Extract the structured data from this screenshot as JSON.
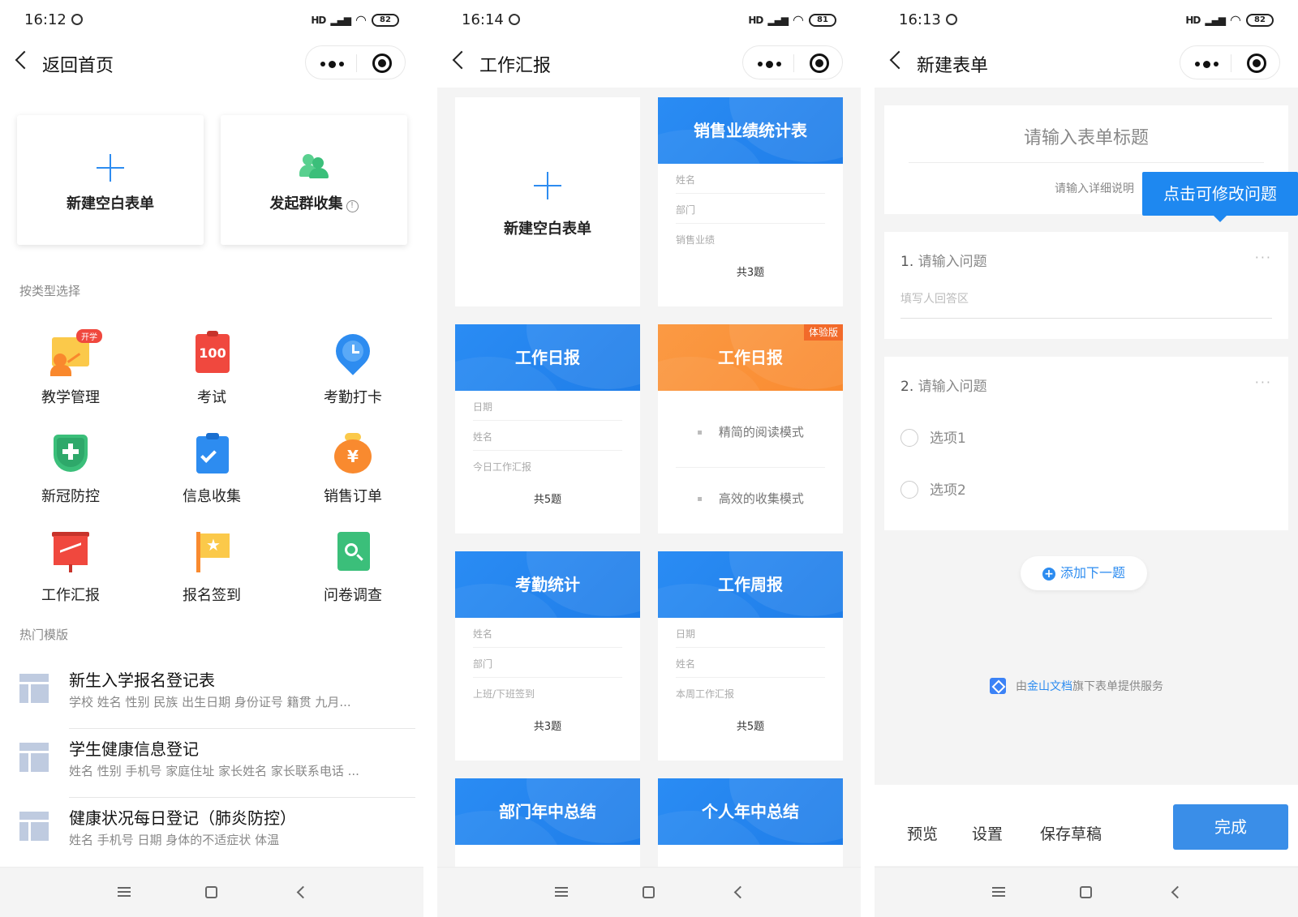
{
  "colors": {
    "accent": "#2d8cf0",
    "orange": "#f98a2f",
    "green": "#3bbf7a",
    "red": "#f0483e"
  },
  "panel1": {
    "status": {
      "time": "16:12",
      "signal": "HD",
      "battery": "82"
    },
    "nav": {
      "title": "返回首页"
    },
    "cards": [
      {
        "label": "新建空白表单",
        "icon": "plus-icon"
      },
      {
        "label": "发起群收集",
        "icon": "people-icon",
        "info": "!"
      }
    ],
    "section_type": "按类型选择",
    "grid": [
      {
        "label": "教学管理",
        "icon": "teacher-icon",
        "badge": "开学"
      },
      {
        "label": "考试",
        "icon": "exam-icon",
        "icon_text": "100"
      },
      {
        "label": "考勤打卡",
        "icon": "clock-pin-icon"
      },
      {
        "label": "新冠防控",
        "icon": "shield-cross-icon"
      },
      {
        "label": "信息收集",
        "icon": "clipboard-check-icon"
      },
      {
        "label": "销售订单",
        "icon": "money-bag-icon",
        "icon_text": "¥"
      },
      {
        "label": "工作汇报",
        "icon": "presentation-icon"
      },
      {
        "label": "报名签到",
        "icon": "flag-star-icon"
      },
      {
        "label": "问卷调查",
        "icon": "search-doc-icon"
      }
    ],
    "section_hot": "热门模版",
    "templates": [
      {
        "title": "新生入学报名登记表",
        "sub": "学校 姓名 性别 民族 出生日期 身份证号 籍贯 九月..."
      },
      {
        "title": "学生健康信息登记",
        "sub": "姓名 性别 手机号 家庭住址 家长姓名 家长联系电话 ..."
      },
      {
        "title": "健康状况每日登记（肺炎防控）",
        "sub": "姓名 手机号 日期 身体的不适症状 体温"
      }
    ]
  },
  "panel2": {
    "status": {
      "time": "16:14",
      "signal": "HD",
      "battery": "81"
    },
    "nav": {
      "title": "工作汇报"
    },
    "blank": {
      "label": "新建空白表单"
    },
    "cards": [
      {
        "title": "销售业绩统计表",
        "fields": [
          "姓名",
          "部门",
          "销售业绩"
        ],
        "count": "共3题"
      },
      {
        "title": "工作日报",
        "fields": [
          "日期",
          "姓名",
          "今日工作汇报"
        ],
        "count": "共5题"
      },
      {
        "title": "工作日报",
        "badge": "体验版",
        "modes": [
          "精简的阅读模式",
          "高效的收集模式"
        ]
      },
      {
        "title": "考勤统计",
        "fields": [
          "姓名",
          "部门",
          "上班/下班签到"
        ],
        "count": "共3题"
      },
      {
        "title": "工作周报",
        "fields": [
          "日期",
          "姓名",
          "本周工作汇报"
        ],
        "count": "共5题"
      },
      {
        "title": "部门年中总结"
      },
      {
        "title": "个人年中总结"
      }
    ]
  },
  "panel3": {
    "status": {
      "time": "16:13",
      "signal": "HD",
      "battery": "82"
    },
    "nav": {
      "title": "新建表单"
    },
    "form_title_placeholder": "请输入表单标题",
    "form_desc_placeholder": "请输入详细说明",
    "tooltip": "点击可修改问题",
    "q1": {
      "num": "1.",
      "label": "请输入问题",
      "answer": "填写人回答区",
      "more": "···"
    },
    "q2": {
      "num": "2.",
      "label": "请输入问题",
      "more": "···",
      "options": [
        "选项1",
        "选项2"
      ]
    },
    "add_label": "添加下一题",
    "add_plus": "+",
    "powered": {
      "pre": "由",
      "brand": "金山文档",
      "post": "旗下表单提供服务"
    },
    "bottom": {
      "preview": "预览",
      "settings": "设置",
      "draft": "保存草稿",
      "done": "完成"
    }
  }
}
